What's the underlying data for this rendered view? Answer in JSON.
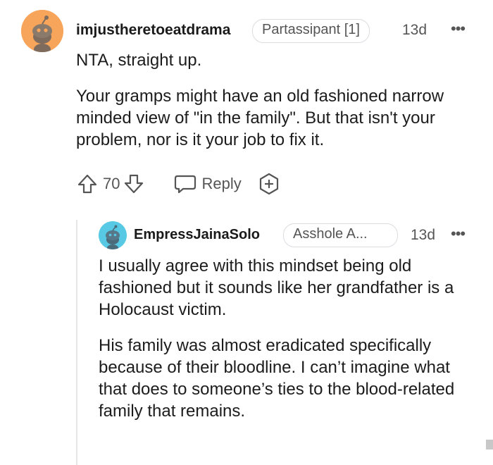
{
  "comment": {
    "username": "imjustheretoeatdrama",
    "flair": "Partassipant [1]",
    "age": "13d",
    "more_label": "•••",
    "paragraphs": [
      "NTA, straight up.",
      "Your gramps might have an old fashioned narrow minded view of \"in the family\". But that isn't your problem, nor is it your job to fix it."
    ],
    "votes": "70",
    "reply_label": "Reply"
  },
  "reply": {
    "username": "EmpressJainaSolo",
    "flair": "Asshole A...",
    "age": "13d",
    "more_label": "•••",
    "paragraphs": [
      "I usually agree with this mindset being old fashioned but it sounds like her grandfather is a Holocaust victim.",
      "His family was almost eradicated specifically because of their bloodline. I can’t imagine what that does to someone’s ties to the blood-related family that remains."
    ]
  },
  "colors": {
    "avatar1_bg": "#f7a55a",
    "avatar2_bg": "#58c9e4",
    "muted": "#555555"
  }
}
